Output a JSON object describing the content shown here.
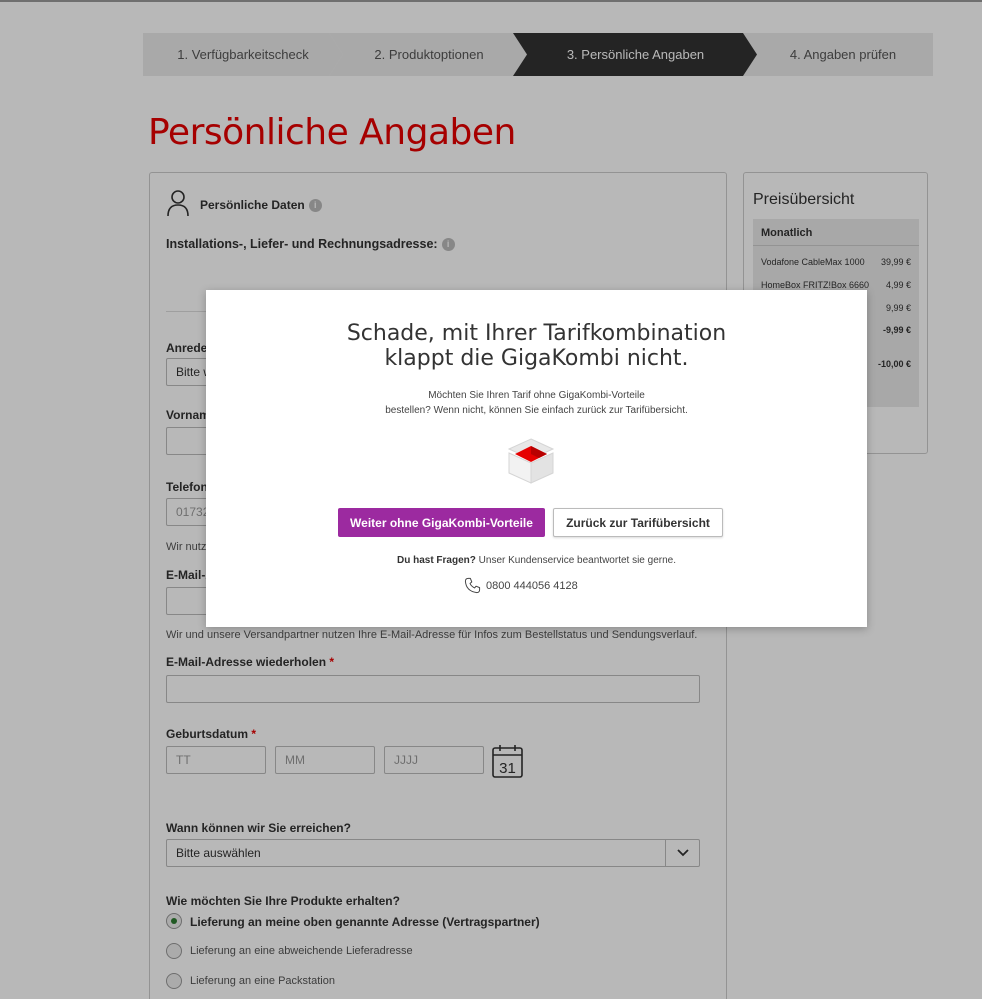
{
  "stepper": {
    "steps": [
      "1. Verfügbarkeitscheck",
      "2. Produktoptionen",
      "3. Persönliche Angaben",
      "4. Angaben prüfen"
    ]
  },
  "page": {
    "title": "Persönliche Angaben"
  },
  "form": {
    "section_title": "Persönliche Daten",
    "address_label": "Installations-, Liefer- und Rechnungsadresse:",
    "salutation_label": "Anrede",
    "salutation_value": "Bitte w",
    "firstname_label": "Vornam",
    "phone_label": "Telefon",
    "phone_value": "01732",
    "phone_note": "Wir nutze",
    "email_label": "E-Mail-A",
    "email_note": "Wir und unsere Versandpartner nutzen Ihre E-Mail-Adresse für Infos zum Bestellstatus und Sendungsverlauf.",
    "email_repeat_label": "E-Mail-Adresse wiederholen",
    "birthdate_label": "Geburtsdatum",
    "birth_day_ph": "TT",
    "birth_month_ph": "MM",
    "birth_year_ph": "JJJJ",
    "calendar_day": "31",
    "reach_label": "Wann können wir Sie erreichen?",
    "reach_value": "Bitte auswählen",
    "delivery_label": "Wie möchten Sie Ihre Produkte erhalten?",
    "delivery_options": [
      "Lieferung an meine oben genannte Adresse (Vertragspartner)",
      "Lieferung an eine abweichende Lieferadresse",
      "Lieferung an eine Packstation"
    ],
    "required_mark": "*"
  },
  "price": {
    "title": "Preisübersicht",
    "monthly_label": "Monatlich",
    "rows": [
      {
        "label": "Vodafone CableMax 1000",
        "value": "39,99 €"
      },
      {
        "label": "HomeBox FRITZ!Box 6660",
        "value": "4,99 €"
      },
      {
        "label": "",
        "value": "9,99 €"
      },
      {
        "label": "",
        "value": "-9,99 €"
      },
      {
        "label": "",
        "value": "-10,00 €"
      }
    ]
  },
  "modal": {
    "title_line1": "Schade, mit Ihrer Tarifkombination",
    "title_line2": "klappt die GigaKombi nicht.",
    "text_line1": "Möchten Sie Ihren Tarif ohne GigaKombi-Vorteile",
    "text_line2": "bestellen? Wenn nicht, können Sie einfach zurück zur Tarifübersicht.",
    "primary_button": "Weiter ohne GigaKombi-Vorteile",
    "secondary_button": "Zurück zur Tarifübersicht",
    "help_bold": "Du hast Fragen?",
    "help_text": " Unser Kundenservice beantwortet sie gerne.",
    "phone_number": "0800 444056 4128"
  },
  "colors": {
    "brand_red": "#e60000",
    "primary_purple": "#9c2aa0",
    "step_active": "#333333"
  }
}
